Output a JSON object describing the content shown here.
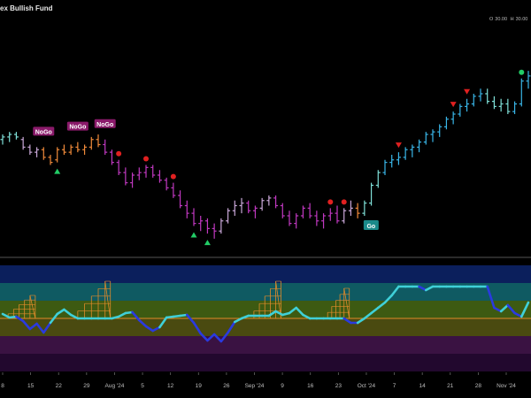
{
  "header": {
    "title": "ex Bullish Fund",
    "ohlc": [
      {
        "key": "O",
        "value": "30.00"
      },
      {
        "key": "H",
        "value": "30.00"
      }
    ]
  },
  "chart_data": {
    "type": "ohlc-bars-with-oscillator",
    "title": "ex Bullish Fund",
    "x_axis": {
      "tick_labels": [
        "8",
        "15",
        "22",
        "29",
        "Aug '24",
        "5",
        "12",
        "19",
        "26",
        "Sep '24",
        "9",
        "16",
        "23",
        "Oct '24",
        "7",
        "14",
        "21",
        "28",
        "Nov '24"
      ]
    },
    "price_series": {
      "colors": {
        "bullish": "#39b6e8",
        "weak_bullish": "#7fe0d8",
        "bearish": "#c038c0",
        "weak_bearish": "#f08a3a",
        "neutral": "#c9a8d8"
      },
      "bars": [
        {
          "i": 0,
          "o": 66,
          "h": 68,
          "l": 64,
          "c": 67,
          "s": "weak_bullish"
        },
        {
          "i": 1,
          "o": 67,
          "h": 69,
          "l": 65,
          "c": 68,
          "s": "weak_bullish"
        },
        {
          "i": 2,
          "o": 68,
          "h": 69,
          "l": 66,
          "c": 67,
          "s": "weak_bullish"
        },
        {
          "i": 3,
          "o": 66,
          "h": 67,
          "l": 62,
          "c": 63,
          "s": "neutral"
        },
        {
          "i": 4,
          "o": 63,
          "h": 64,
          "l": 60,
          "c": 61,
          "s": "neutral"
        },
        {
          "i": 5,
          "o": 61,
          "h": 63,
          "l": 59,
          "c": 62,
          "s": "neutral"
        },
        {
          "i": 6,
          "o": 62,
          "h": 63,
          "l": 58,
          "c": 59,
          "s": "weak_bearish"
        },
        {
          "i": 7,
          "o": 59,
          "h": 60,
          "l": 56,
          "c": 57,
          "s": "weak_bearish"
        },
        {
          "i": 8,
          "o": 58,
          "h": 63,
          "l": 57,
          "c": 62,
          "s": "weak_bearish"
        },
        {
          "i": 9,
          "o": 62,
          "h": 64,
          "l": 60,
          "c": 61,
          "s": "weak_bearish"
        },
        {
          "i": 10,
          "o": 61,
          "h": 64,
          "l": 60,
          "c": 63,
          "s": "weak_bearish"
        },
        {
          "i": 11,
          "o": 63,
          "h": 65,
          "l": 61,
          "c": 62,
          "s": "weak_bearish"
        },
        {
          "i": 12,
          "o": 62,
          "h": 64,
          "l": 60,
          "c": 63,
          "s": "weak_bearish"
        },
        {
          "i": 13,
          "o": 63,
          "h": 67,
          "l": 62,
          "c": 66,
          "s": "weak_bearish"
        },
        {
          "i": 14,
          "o": 66,
          "h": 68,
          "l": 63,
          "c": 64,
          "s": "weak_bearish"
        },
        {
          "i": 15,
          "o": 64,
          "h": 66,
          "l": 60,
          "c": 61,
          "s": "bearish"
        },
        {
          "i": 16,
          "o": 61,
          "h": 62,
          "l": 56,
          "c": 57,
          "s": "bearish"
        },
        {
          "i": 17,
          "o": 57,
          "h": 58,
          "l": 52,
          "c": 53,
          "s": "bearish"
        },
        {
          "i": 18,
          "o": 53,
          "h": 55,
          "l": 48,
          "c": 49,
          "s": "bearish"
        },
        {
          "i": 19,
          "o": 49,
          "h": 53,
          "l": 47,
          "c": 52,
          "s": "bearish"
        },
        {
          "i": 20,
          "o": 52,
          "h": 55,
          "l": 50,
          "c": 53,
          "s": "bearish"
        },
        {
          "i": 21,
          "o": 53,
          "h": 56,
          "l": 51,
          "c": 55,
          "s": "bearish"
        },
        {
          "i": 22,
          "o": 55,
          "h": 56,
          "l": 51,
          "c": 52,
          "s": "bearish"
        },
        {
          "i": 23,
          "o": 52,
          "h": 54,
          "l": 49,
          "c": 50,
          "s": "bearish"
        },
        {
          "i": 24,
          "o": 50,
          "h": 51,
          "l": 46,
          "c": 47,
          "s": "bearish"
        },
        {
          "i": 25,
          "o": 47,
          "h": 49,
          "l": 43,
          "c": 44,
          "s": "bearish"
        },
        {
          "i": 26,
          "o": 44,
          "h": 46,
          "l": 39,
          "c": 40,
          "s": "bearish"
        },
        {
          "i": 27,
          "o": 40,
          "h": 42,
          "l": 35,
          "c": 37,
          "s": "bearish"
        },
        {
          "i": 28,
          "o": 37,
          "h": 39,
          "l": 32,
          "c": 33,
          "s": "bearish"
        },
        {
          "i": 29,
          "o": 33,
          "h": 36,
          "l": 30,
          "c": 34,
          "s": "bearish"
        },
        {
          "i": 30,
          "o": 34,
          "h": 35,
          "l": 29,
          "c": 31,
          "s": "bearish"
        },
        {
          "i": 31,
          "o": 31,
          "h": 33,
          "l": 27,
          "c": 30,
          "s": "bearish"
        },
        {
          "i": 32,
          "o": 30,
          "h": 35,
          "l": 29,
          "c": 34,
          "s": "neutral"
        },
        {
          "i": 33,
          "o": 34,
          "h": 39,
          "l": 33,
          "c": 38,
          "s": "neutral"
        },
        {
          "i": 34,
          "o": 38,
          "h": 42,
          "l": 36,
          "c": 40,
          "s": "neutral"
        },
        {
          "i": 35,
          "o": 40,
          "h": 43,
          "l": 37,
          "c": 41,
          "s": "neutral"
        },
        {
          "i": 36,
          "o": 41,
          "h": 42,
          "l": 37,
          "c": 38,
          "s": "bearish"
        },
        {
          "i": 37,
          "o": 38,
          "h": 40,
          "l": 35,
          "c": 39,
          "s": "bearish"
        },
        {
          "i": 38,
          "o": 39,
          "h": 43,
          "l": 38,
          "c": 42,
          "s": "neutral"
        },
        {
          "i": 39,
          "o": 42,
          "h": 44,
          "l": 40,
          "c": 43,
          "s": "neutral"
        },
        {
          "i": 40,
          "o": 43,
          "h": 44,
          "l": 39,
          "c": 40,
          "s": "bearish"
        },
        {
          "i": 41,
          "o": 40,
          "h": 41,
          "l": 35,
          "c": 36,
          "s": "bearish"
        },
        {
          "i": 42,
          "o": 36,
          "h": 38,
          "l": 32,
          "c": 33,
          "s": "bearish"
        },
        {
          "i": 43,
          "o": 33,
          "h": 37,
          "l": 31,
          "c": 36,
          "s": "bearish"
        },
        {
          "i": 44,
          "o": 36,
          "h": 40,
          "l": 35,
          "c": 39,
          "s": "bearish"
        },
        {
          "i": 45,
          "o": 39,
          "h": 41,
          "l": 35,
          "c": 36,
          "s": "bearish"
        },
        {
          "i": 46,
          "o": 36,
          "h": 38,
          "l": 32,
          "c": 34,
          "s": "bearish"
        },
        {
          "i": 47,
          "o": 34,
          "h": 37,
          "l": 31,
          "c": 36,
          "s": "bearish"
        },
        {
          "i": 48,
          "o": 36,
          "h": 39,
          "l": 34,
          "c": 37,
          "s": "bearish"
        },
        {
          "i": 49,
          "o": 37,
          "h": 40,
          "l": 33,
          "c": 34,
          "s": "bearish"
        },
        {
          "i": 50,
          "o": 34,
          "h": 39,
          "l": 33,
          "c": 38,
          "s": "neutral"
        },
        {
          "i": 51,
          "o": 38,
          "h": 42,
          "l": 36,
          "c": 39,
          "s": "neutral"
        },
        {
          "i": 52,
          "o": 39,
          "h": 41,
          "l": 35,
          "c": 37,
          "s": "weak_bearish"
        },
        {
          "i": 53,
          "o": 37,
          "h": 42,
          "l": 36,
          "c": 41,
          "s": "weak_bullish"
        },
        {
          "i": 54,
          "o": 41,
          "h": 49,
          "l": 40,
          "c": 48,
          "s": "weak_bullish"
        },
        {
          "i": 55,
          "o": 48,
          "h": 54,
          "l": 47,
          "c": 53,
          "s": "weak_bullish"
        },
        {
          "i": 56,
          "o": 53,
          "h": 58,
          "l": 52,
          "c": 57,
          "s": "bullish"
        },
        {
          "i": 57,
          "o": 57,
          "h": 60,
          "l": 55,
          "c": 58,
          "s": "bullish"
        },
        {
          "i": 58,
          "o": 58,
          "h": 61,
          "l": 56,
          "c": 59,
          "s": "bullish"
        },
        {
          "i": 59,
          "o": 59,
          "h": 63,
          "l": 58,
          "c": 62,
          "s": "bullish"
        },
        {
          "i": 60,
          "o": 62,
          "h": 64,
          "l": 59,
          "c": 63,
          "s": "bullish"
        },
        {
          "i": 61,
          "o": 63,
          "h": 66,
          "l": 61,
          "c": 65,
          "s": "bullish"
        },
        {
          "i": 62,
          "o": 65,
          "h": 69,
          "l": 64,
          "c": 68,
          "s": "bullish"
        },
        {
          "i": 63,
          "o": 68,
          "h": 70,
          "l": 65,
          "c": 69,
          "s": "bullish"
        },
        {
          "i": 64,
          "o": 69,
          "h": 72,
          "l": 67,
          "c": 71,
          "s": "bullish"
        },
        {
          "i": 65,
          "o": 71,
          "h": 75,
          "l": 70,
          "c": 74,
          "s": "bullish"
        },
        {
          "i": 66,
          "o": 74,
          "h": 77,
          "l": 72,
          "c": 76,
          "s": "bullish"
        },
        {
          "i": 67,
          "o": 76,
          "h": 80,
          "l": 75,
          "c": 79,
          "s": "bullish"
        },
        {
          "i": 68,
          "o": 79,
          "h": 82,
          "l": 77,
          "c": 80,
          "s": "bullish"
        },
        {
          "i": 69,
          "o": 80,
          "h": 84,
          "l": 79,
          "c": 83,
          "s": "bullish"
        },
        {
          "i": 70,
          "o": 83,
          "h": 86,
          "l": 81,
          "c": 84,
          "s": "bullish"
        },
        {
          "i": 71,
          "o": 84,
          "h": 86,
          "l": 80,
          "c": 81,
          "s": "weak_bullish"
        },
        {
          "i": 72,
          "o": 81,
          "h": 83,
          "l": 78,
          "c": 79,
          "s": "weak_bullish"
        },
        {
          "i": 73,
          "o": 79,
          "h": 82,
          "l": 77,
          "c": 80,
          "s": "weak_bullish"
        },
        {
          "i": 74,
          "o": 80,
          "h": 82,
          "l": 76,
          "c": 77,
          "s": "weak_bullish"
        },
        {
          "i": 75,
          "o": 77,
          "h": 81,
          "l": 76,
          "c": 80,
          "s": "bullish"
        },
        {
          "i": 76,
          "o": 80,
          "h": 90,
          "l": 79,
          "c": 89,
          "s": "bullish"
        },
        {
          "i": 77,
          "o": 89,
          "h": 93,
          "l": 86,
          "c": 91,
          "s": "bullish"
        }
      ],
      "y_range": [
        20,
        100
      ]
    },
    "markers": [
      {
        "type": "nogo-label",
        "text": "NoGo",
        "bar": 6
      },
      {
        "type": "nogo-label",
        "text": "NoGo",
        "bar": 11
      },
      {
        "type": "nogo-label",
        "text": "NoGo",
        "bar": 15
      },
      {
        "type": "go-label",
        "text": "Go",
        "bar": 53
      },
      {
        "type": "up-triangle",
        "color": "#22cc66",
        "bar": 8
      },
      {
        "type": "up-triangle",
        "color": "#22cc66",
        "bar": 28
      },
      {
        "type": "up-triangle",
        "color": "#22cc66",
        "bar": 30
      },
      {
        "type": "down-triangle",
        "color": "#e02020",
        "bar": 58
      },
      {
        "type": "down-triangle",
        "color": "#e02020",
        "bar": 66
      },
      {
        "type": "down-triangle",
        "color": "#e02020",
        "bar": 68
      },
      {
        "type": "dot",
        "color": "#e02020",
        "bar": 17
      },
      {
        "type": "dot",
        "color": "#e02020",
        "bar": 21
      },
      {
        "type": "dot",
        "color": "#e02020",
        "bar": 25
      },
      {
        "type": "dot",
        "color": "#e02020",
        "bar": 48
      },
      {
        "type": "dot",
        "color": "#e02020",
        "bar": 50
      },
      {
        "type": "dot",
        "color": "#22cc66",
        "bar": 76
      }
    ],
    "oscillator": {
      "y_range": [
        -6,
        6
      ],
      "zero_line": 0,
      "bands": [
        {
          "from": 4,
          "to": 6,
          "color": "#0b1f5c"
        },
        {
          "from": 2,
          "to": 4,
          "color": "#0f5a62"
        },
        {
          "from": 0,
          "to": 2,
          "color": "#3d5a12"
        },
        {
          "from": -2,
          "to": 0,
          "color": "#4a4a10"
        },
        {
          "from": -4,
          "to": -2,
          "color": "#3a1242"
        },
        {
          "from": -6,
          "to": -4,
          "color": "#22082e"
        }
      ],
      "line_colors": {
        "bullish": "#3fd0d8",
        "bearish": "#2a3ae0"
      },
      "values": [
        0.5,
        0.1,
        0.2,
        -0.3,
        -1.2,
        -0.6,
        -1.6,
        -0.5,
        0.5,
        1,
        0.4,
        0,
        0,
        0,
        0,
        0,
        0,
        0.2,
        0.6,
        0.7,
        -0.2,
        -0.9,
        -1.4,
        -1.0,
        0.1,
        0.2,
        0.3,
        0.4,
        -0.5,
        -1.7,
        -2.5,
        -1.8,
        -2.6,
        -1.6,
        -0.4,
        0,
        0.3,
        0.3,
        0.3,
        0.3,
        0.8,
        0.4,
        0.6,
        1.2,
        0.4,
        0,
        0,
        0,
        0,
        0,
        0,
        -0.5,
        -0.5,
        0,
        0.6,
        1.2,
        1.8,
        2.6,
        3.6,
        3.6,
        3.6,
        3.6,
        3.2,
        3.6,
        3.6,
        3.6,
        3.6,
        3.6,
        3.6,
        3.6,
        3.6,
        3.6,
        1.2,
        0.8,
        1.5,
        0.6,
        0.2,
        1.8
      ],
      "bull_until_index": 57,
      "histogram_bars": [
        {
          "type": "fan",
          "start": 0,
          "peak": 4,
          "value": 2.6
        },
        {
          "type": "fan",
          "start": 10,
          "peak": 15,
          "value": 4.2
        },
        {
          "type": "fan",
          "start": 36,
          "peak": 40,
          "value": 4.2
        },
        {
          "type": "fan",
          "start": 47,
          "peak": 50,
          "value": 3.4
        }
      ],
      "orange_line_color": "#e08a2a"
    }
  }
}
